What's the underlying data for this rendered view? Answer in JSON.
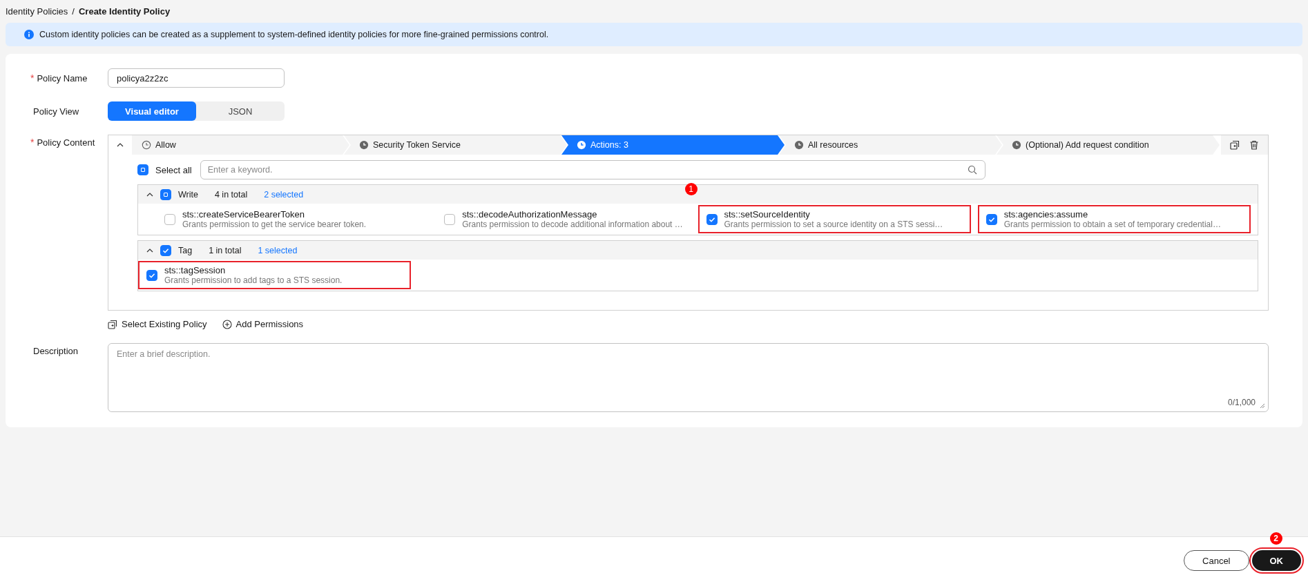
{
  "breadcrumb": {
    "items": [
      {
        "label": "Identity Policies",
        "current": false
      },
      {
        "label": "Create Identity Policy",
        "current": true
      }
    ],
    "separator": "/"
  },
  "notice": "Custom identity policies can be created as a supplement to system-defined identity policies for more fine-grained permissions control.",
  "form": {
    "policy_name": {
      "label": "Policy Name",
      "required_mark": "*",
      "value": "policya2z2zc"
    },
    "policy_view": {
      "label": "Policy View",
      "options": [
        {
          "label": "Visual editor",
          "selected": true
        },
        {
          "label": "JSON",
          "selected": false
        }
      ]
    },
    "policy_content": {
      "label": "Policy Content",
      "required_mark": "*",
      "expanded": true,
      "steps": [
        {
          "label": "Allow",
          "selected": false
        },
        {
          "label": "Security Token Service",
          "selected": false
        },
        {
          "label": "Actions: 3",
          "selected": true
        },
        {
          "label": "All resources",
          "selected": false
        },
        {
          "label": "(Optional) Add request condition",
          "selected": false
        }
      ],
      "select_all": {
        "label": "Select all",
        "kind": "partial"
      },
      "search": {
        "placeholder": "Enter a keyword."
      },
      "groups": [
        {
          "name": "Write",
          "expanded": true,
          "kind": "partial",
          "total": "4 in total",
          "selected_count": "2 selected",
          "actions": [
            {
              "name": "sts::createServiceBearerToken",
              "description": "Grants permission to get the service bearer token.",
              "checked": false,
              "highlighted": false
            },
            {
              "name": "sts::decodeAuthorizationMessage",
              "description": "Grants permission to decode additional information about …",
              "checked": false,
              "highlighted": false
            },
            {
              "name": "sts::setSourceIdentity",
              "description": "Grants permission to set a source identity on a STS sessi…",
              "checked": true,
              "highlighted": true,
              "marker": "1"
            },
            {
              "name": "sts:agencies:assume",
              "description": "Grants permission to obtain a set of temporary credential…",
              "checked": true,
              "highlighted": true
            }
          ]
        },
        {
          "name": "Tag",
          "expanded": true,
          "kind": "checked",
          "total": "1 in total",
          "selected_count": "1 selected",
          "actions": [
            {
              "name": "sts::tagSession",
              "description": "Grants permission to add tags to a STS session.",
              "checked": true,
              "highlighted": true
            }
          ]
        }
      ],
      "links": [
        {
          "label": "Select Existing Policy",
          "kind": "policy"
        },
        {
          "label": "Add Permissions",
          "kind": "add"
        }
      ]
    },
    "description": {
      "label": "Description",
      "placeholder": "Enter a brief description.",
      "counter": "0/1,000"
    }
  },
  "footer": {
    "buttons": [
      {
        "label": "Cancel",
        "kind": "secondary",
        "highlighted": false
      },
      {
        "label": "OK",
        "kind": "primary",
        "highlighted": true,
        "marker": "2"
      }
    ]
  }
}
